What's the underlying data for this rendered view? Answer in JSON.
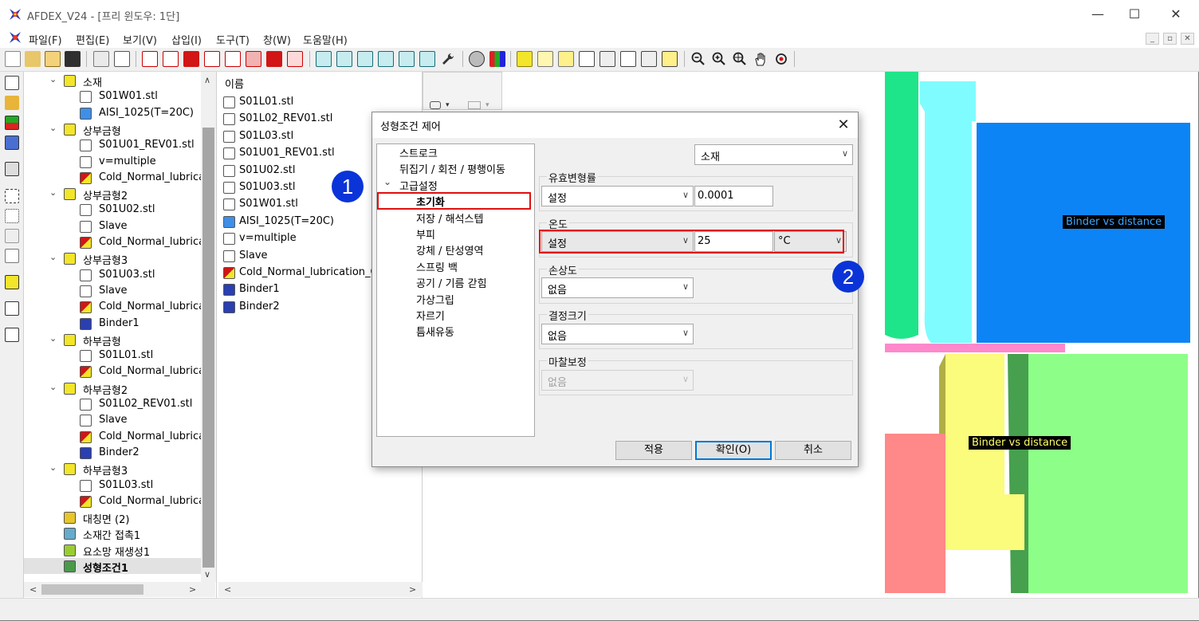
{
  "window": {
    "title": "AFDEX_V24 - [프리 윈도우: 1단]",
    "controls": [
      "—",
      "☐",
      "✕"
    ]
  },
  "menu": [
    "파일(F)",
    "편집(E)",
    "보기(V)",
    "삽입(I)",
    "도구(T)",
    "창(W)",
    "도움말(H)"
  ],
  "tree": {
    "items": [
      {
        "label": "소재",
        "level": 1,
        "caret": true
      },
      {
        "label": "S01W01.stl",
        "level": 2
      },
      {
        "label": "AISI_1025(T=20C)",
        "level": 2
      },
      {
        "label": "상부금형",
        "level": 1,
        "caret": true
      },
      {
        "label": "S01U01_REV01.stl",
        "level": 2
      },
      {
        "label": "v=multiple",
        "level": 2
      },
      {
        "label": "Cold_Normal_lubricat",
        "level": 2
      },
      {
        "label": "상부금형2",
        "level": 1,
        "caret": true
      },
      {
        "label": "S01U02.stl",
        "level": 2
      },
      {
        "label": "Slave",
        "level": 2
      },
      {
        "label": "Cold_Normal_lubricat",
        "level": 2
      },
      {
        "label": "상부금형3",
        "level": 1,
        "caret": true
      },
      {
        "label": "S01U03.stl",
        "level": 2
      },
      {
        "label": "Slave",
        "level": 2
      },
      {
        "label": "Cold_Normal_lubricat",
        "level": 2
      },
      {
        "label": "Binder1",
        "level": 2
      },
      {
        "label": "하부금형",
        "level": 1,
        "caret": true
      },
      {
        "label": "S01L01.stl",
        "level": 2
      },
      {
        "label": "Cold_Normal_lubricat",
        "level": 2
      },
      {
        "label": "하부금형2",
        "level": 1,
        "caret": true
      },
      {
        "label": "S01L02_REV01.stl",
        "level": 2
      },
      {
        "label": "Slave",
        "level": 2
      },
      {
        "label": "Cold_Normal_lubricat",
        "level": 2
      },
      {
        "label": "Binder2",
        "level": 2
      },
      {
        "label": "하부금형3",
        "level": 1,
        "caret": true
      },
      {
        "label": "S01L03.stl",
        "level": 2
      },
      {
        "label": "Cold_Normal_lubricat",
        "level": 2
      },
      {
        "label": "대칭면 (2)",
        "level": 1
      },
      {
        "label": "소재간 접촉1",
        "level": 1
      },
      {
        "label": "요소망 재생성1",
        "level": 1
      },
      {
        "label": "성형조건1",
        "level": 1,
        "bold": true,
        "selected": true
      }
    ]
  },
  "list": {
    "header": "이름",
    "items": [
      "S01L01.stl",
      "S01L02_REV01.stl",
      "S01L03.stl",
      "S01U01_REV01.stl",
      "S01U02.stl",
      "S01U03.stl",
      "S01W01.stl",
      "AISI_1025(T=20C)",
      "v=multiple",
      "Slave",
      "Cold_Normal_lubrication_Co",
      "Binder1",
      "Binder2"
    ]
  },
  "dialog": {
    "title": "성형조건 제어",
    "close": "✕",
    "nav": [
      {
        "label": "스트로크",
        "level": 1
      },
      {
        "label": "뒤집기 / 회전 / 평행이동",
        "level": 1
      },
      {
        "label": "고급설정",
        "level": 1,
        "caret": "⌄"
      },
      {
        "label": "초기화",
        "level": 2,
        "selected": true
      },
      {
        "label": "저장 / 해석스텝",
        "level": 2
      },
      {
        "label": "부피",
        "level": 2
      },
      {
        "label": "강체 / 탄성영역",
        "level": 2
      },
      {
        "label": "스프링 백",
        "level": 2
      },
      {
        "label": "공기 / 기름 갇힘",
        "level": 2
      },
      {
        "label": "가상그립",
        "level": 2
      },
      {
        "label": "자르기",
        "level": 2
      },
      {
        "label": "틈새유동",
        "level": 2
      }
    ],
    "target_select": "소재",
    "strain_label": "유효변형률",
    "strain_mode": "설정",
    "strain_value": "0.0001",
    "temp_label": "온도",
    "temp_mode": "설정",
    "temp_value": "25",
    "temp_unit": "°C",
    "damage_label": "손상도",
    "damage_value": "없음",
    "grain_label": "결정크기",
    "grain_value": "없음",
    "friction_label": "마찰보정",
    "friction_value": "없음",
    "buttons": {
      "apply": "적용",
      "ok": "확인(O)",
      "cancel": "취소"
    }
  },
  "callouts": [
    "1",
    "2"
  ],
  "viewport": {
    "labels": [
      "Binder vs distance",
      "Binder vs distance"
    ],
    "label_colors": [
      "#3da5ff",
      "#ffff66"
    ]
  },
  "colors": {
    "accent_red": "#e01010",
    "badge_blue": "#0a34d8",
    "focus_blue": "#0078d7"
  }
}
